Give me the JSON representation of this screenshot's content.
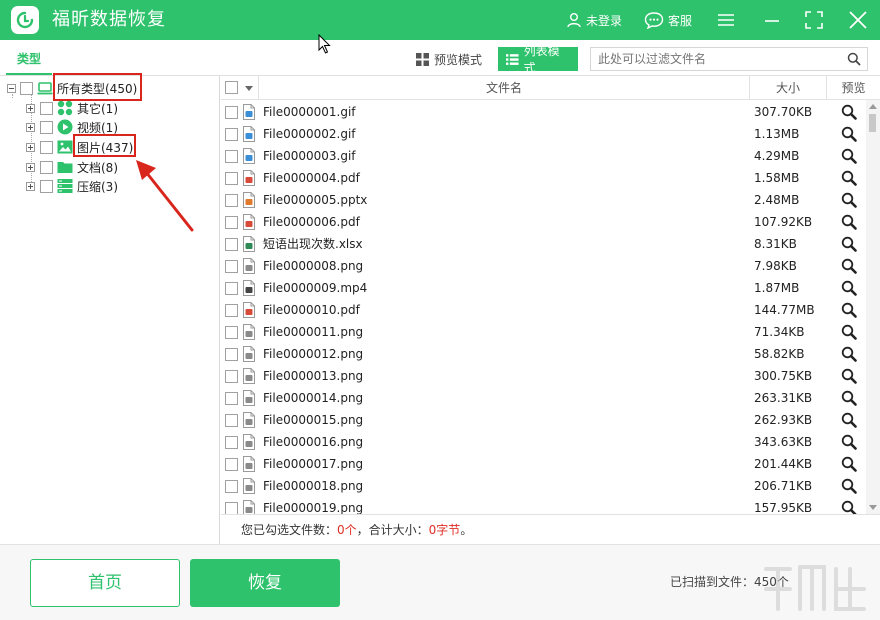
{
  "app": {
    "title": "福昕数据恢复",
    "accent_color": "#2dc26b",
    "highlight_color": "#d8261d"
  },
  "titlebar": {
    "login_label": "未登录",
    "service_label": "客服",
    "icons": [
      "user-icon",
      "chat-icon",
      "menu-icon",
      "minimize-icon",
      "maximize-icon",
      "close-icon"
    ]
  },
  "toolbar": {
    "type_tab_label": "类型",
    "preview_mode_label": "预览模式",
    "list_mode_label": "列表模式",
    "search_placeholder": "此处可以过滤文件名"
  },
  "tree": {
    "root_label": "所有类型(450)",
    "items": [
      {
        "label": "其它(1)",
        "icon": "apps-icon"
      },
      {
        "label": "视频(1)",
        "icon": "video-icon"
      },
      {
        "label": "图片(437)",
        "icon": "image-icon"
      },
      {
        "label": "文档(8)",
        "icon": "folder-icon"
      },
      {
        "label": "压缩(3)",
        "icon": "archive-icon"
      }
    ]
  },
  "list": {
    "columns": {
      "name": "文件名",
      "size": "大小",
      "preview": "预览"
    },
    "rows": [
      {
        "name": "File0000001.gif",
        "size": "307.70KB",
        "type": "gif"
      },
      {
        "name": "File0000002.gif",
        "size": "1.13MB",
        "type": "gif"
      },
      {
        "name": "File0000003.gif",
        "size": "4.29MB",
        "type": "gif"
      },
      {
        "name": "File0000004.pdf",
        "size": "1.58MB",
        "type": "pdf"
      },
      {
        "name": "File0000005.pptx",
        "size": "2.48MB",
        "type": "pptx"
      },
      {
        "name": "File0000006.pdf",
        "size": "107.92KB",
        "type": "pdf"
      },
      {
        "name": "短语出现次数.xlsx",
        "size": "8.31KB",
        "type": "xlsx"
      },
      {
        "name": "File0000008.png",
        "size": "7.98KB",
        "type": "png"
      },
      {
        "name": "File0000009.mp4",
        "size": "1.87MB",
        "type": "mp4"
      },
      {
        "name": "File0000010.pdf",
        "size": "144.77MB",
        "type": "pdf"
      },
      {
        "name": "File0000011.png",
        "size": "71.34KB",
        "type": "png"
      },
      {
        "name": "File0000012.png",
        "size": "58.82KB",
        "type": "png"
      },
      {
        "name": "File0000013.png",
        "size": "300.75KB",
        "type": "png"
      },
      {
        "name": "File0000014.png",
        "size": "263.31KB",
        "type": "png"
      },
      {
        "name": "File0000015.png",
        "size": "262.93KB",
        "type": "png"
      },
      {
        "name": "File0000016.png",
        "size": "343.63KB",
        "type": "png"
      },
      {
        "name": "File0000017.png",
        "size": "201.44KB",
        "type": "png"
      },
      {
        "name": "File0000018.png",
        "size": "206.71KB",
        "type": "png"
      },
      {
        "name": "File0000019.png",
        "size": "157.95KB",
        "type": "png"
      }
    ]
  },
  "status": {
    "prefix": "您已勾选文件数：",
    "count": "0个",
    "mid": "，合计大小：",
    "size": "0字节",
    "suffix": "。"
  },
  "footer": {
    "home_label": "首页",
    "recover_label": "恢复",
    "scan_info": "已扫描到文件：450个"
  }
}
